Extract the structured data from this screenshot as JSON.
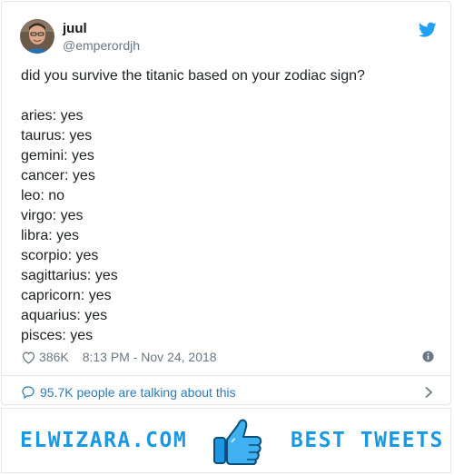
{
  "user": {
    "name": "juul",
    "handle": "@emperordjh"
  },
  "tweet": {
    "question": "did you survive the titanic based on your zodiac sign?",
    "lines": [
      "aries: yes",
      "taurus: yes",
      "gemini: yes",
      "cancer: yes",
      "leo: no",
      "virgo: yes",
      "libra: yes",
      "scorpio: yes",
      "sagittarius: yes",
      "capricorn: yes",
      "aquarius: yes",
      "pisces: yes"
    ],
    "likes": "386K",
    "timestamp": "8:13 PM - Nov 24, 2018",
    "talking": "95.7K people are talking about this"
  },
  "banner": {
    "left_text": "ELWIZARA.COM",
    "right_text": "BEST TWEETS"
  },
  "icons": {
    "platform": "twitter-bird-icon",
    "like": "heart-icon",
    "info": "info-icon",
    "talk": "speech-bubble-icon",
    "more": "chevron-right-icon",
    "banner": "thumbs-up-icon"
  },
  "colors": {
    "twitter_blue": "#1da1f2",
    "link_blue": "#2b7bb9",
    "brand_blue": "#1b98e3"
  }
}
